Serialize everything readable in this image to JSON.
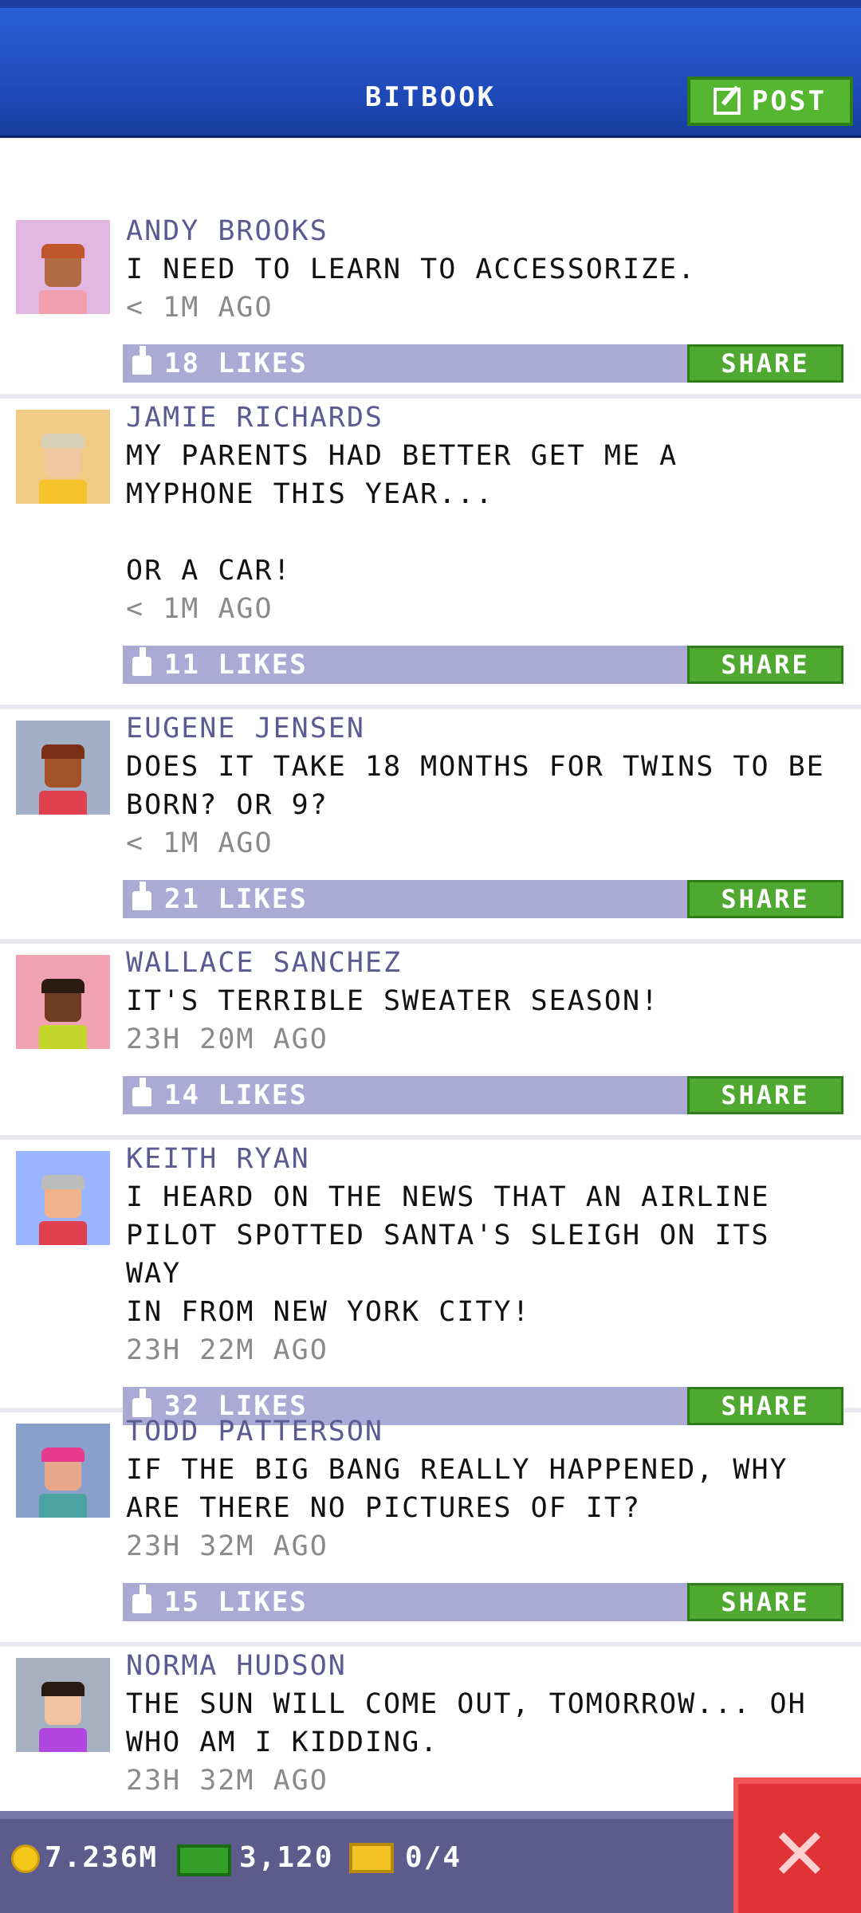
{
  "header": {
    "title": "BITBOOK",
    "post_label": "POST"
  },
  "posts": [
    {
      "name": "ANDY BROOKS",
      "message": "I NEED TO LEARN TO ACCESSORIZE.",
      "time": "< 1M AGO",
      "likes": "18 LIKES",
      "share": "SHARE",
      "avatar": {
        "bg": "#e2b8e2",
        "skin": "#b06a44",
        "hair": "#c0542a",
        "shirt": "#f2a0b0"
      }
    },
    {
      "name": "JAMIE RICHARDS",
      "message": "MY PARENTS HAD BETTER GET ME A\nMYPHONE THIS YEAR...\n\nOR A CAR!",
      "time": "< 1M AGO",
      "likes": "11 LIKES",
      "share": "SHARE",
      "avatar": {
        "bg": "#efcb86",
        "skin": "#f1c9a0",
        "hair": "#d8d0b8",
        "shirt": "#f6c22a"
      }
    },
    {
      "name": "EUGENE JENSEN",
      "message": "DOES IT TAKE 18 MONTHS FOR TWINS TO BE\nBORN? OR 9?",
      "time": "< 1M AGO",
      "likes": "21 LIKES",
      "share": "SHARE",
      "avatar": {
        "bg": "#a3aec7",
        "skin": "#a3522c",
        "hair": "#7a3016",
        "shirt": "#e0404e"
      }
    },
    {
      "name": "WALLACE SANCHEZ",
      "message": "IT'S TERRIBLE SWEATER SEASON!",
      "time": "23H 20M AGO",
      "likes": "14 LIKES",
      "share": "SHARE",
      "avatar": {
        "bg": "#f0a2b2",
        "skin": "#6e3c22",
        "hair": "#2a1a10",
        "shirt": "#c3d62a"
      }
    },
    {
      "name": "KEITH RYAN",
      "message": "I HEARD ON THE NEWS THAT AN AIRLINE\nPILOT SPOTTED SANTA'S SLEIGH ON ITS WAY\nIN FROM NEW YORK CITY!",
      "time": "23H 22M AGO",
      "likes": "32 LIKES",
      "share": "SHARE",
      "avatar": {
        "bg": "#9ab4ff",
        "skin": "#f0b28a",
        "hair": "#bcbcbc",
        "shirt": "#e0404e"
      }
    },
    {
      "name": "TODD PATTERSON",
      "message": "IF THE BIG BANG REALLY HAPPENED, WHY\nARE THERE NO PICTURES OF IT?",
      "time": "23H 32M AGO",
      "likes": "15 LIKES",
      "share": "SHARE",
      "avatar": {
        "bg": "#8aa0cc",
        "skin": "#e7a78a",
        "hair": "#e83a8e",
        "shirt": "#4aa3a0"
      }
    },
    {
      "name": "NORMA HUDSON",
      "message": "THE SUN WILL COME OUT, TOMORROW... OH\nWHO AM I KIDDING.",
      "time": "23H 32M AGO",
      "likes": "",
      "share": "",
      "avatar": {
        "bg": "#a7b0c0",
        "skin": "#f2c3a2",
        "hair": "#2a1a14",
        "shirt": "#b246e0"
      }
    }
  ],
  "bottom": {
    "coins": "7.236M",
    "bux": "3,120",
    "tickets": "0/4"
  },
  "icons": {
    "post": "edit-icon",
    "like": "thumbs-up-icon",
    "coin": "coin-icon",
    "bux": "cash-icon",
    "ticket": "ticket-icon",
    "close": "close-icon"
  }
}
